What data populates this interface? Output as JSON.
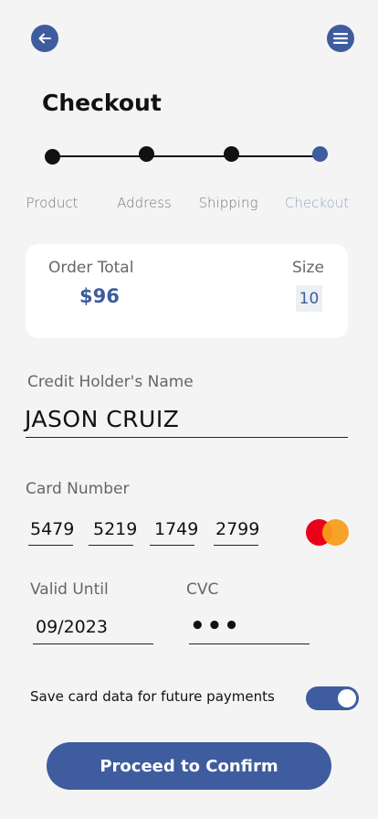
{
  "header": {
    "title": "Checkout",
    "back_icon": "arrow-left-icon",
    "menu_icon": "menu-icon"
  },
  "stepper": {
    "steps": [
      "Product",
      "Address",
      "Shipping",
      "Checkout"
    ],
    "active_index": 3
  },
  "order": {
    "total_label": "Order Total",
    "total_value": "$96",
    "size_label": "Size",
    "size_value": "10"
  },
  "form": {
    "name_label": "Credit Holder's Name",
    "name_value": "JASON CRUIZ",
    "card_label": "Card Number",
    "card_groups": [
      "5479",
      "5219",
      "1749",
      "2799"
    ],
    "card_brand_icon": "mastercard-icon",
    "valid_label": "Valid Until",
    "valid_value": "09/2023",
    "cvc_label": "CVC",
    "cvc_value": "•••"
  },
  "save": {
    "label": "Save card data for future payments",
    "enabled": true
  },
  "actions": {
    "proceed_label": "Proceed to Confirm"
  },
  "colors": {
    "accent": "#3e5c9e",
    "background": "#f4f4f4"
  }
}
